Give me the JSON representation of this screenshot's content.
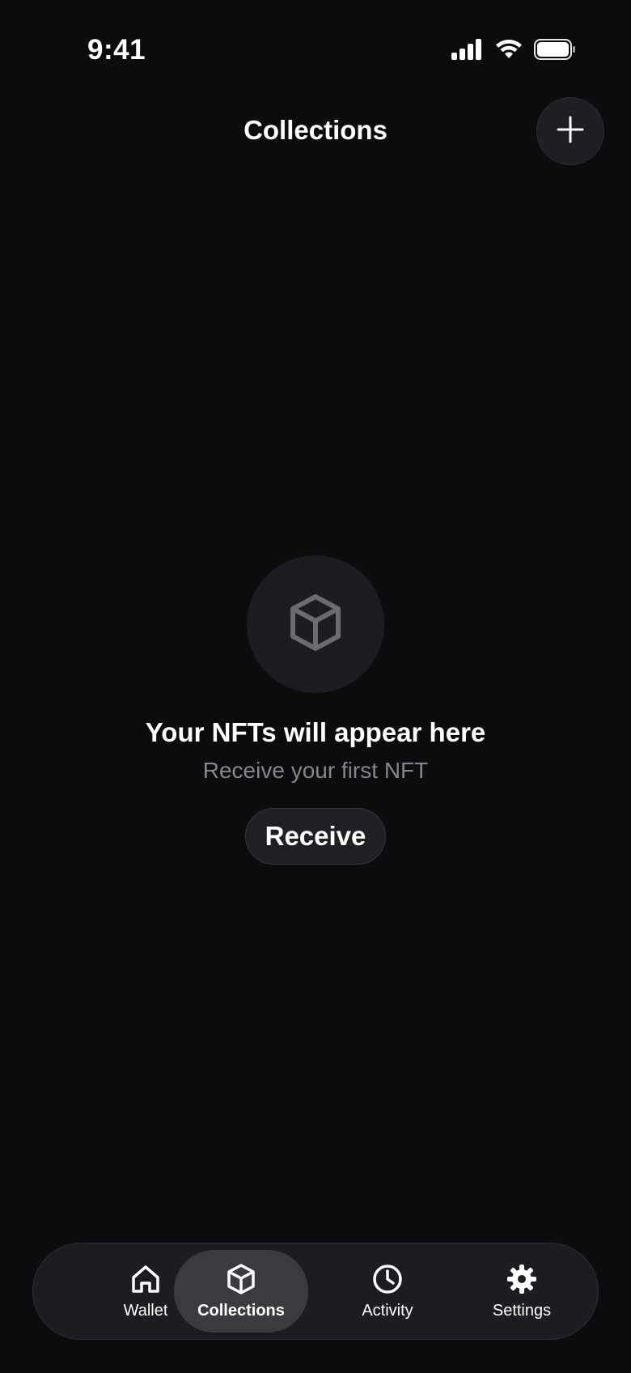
{
  "status_bar": {
    "time": "9:41",
    "icons": [
      "signal-icon",
      "wifi-icon",
      "battery-icon"
    ]
  },
  "header": {
    "title": "Collections",
    "add_icon": "plus-icon"
  },
  "empty_state": {
    "icon": "cube-icon",
    "title": "Your NFTs will appear here",
    "subtitle": "Receive your first NFT",
    "button_label": "Receive"
  },
  "tab_bar": {
    "tabs": [
      {
        "label": "Wallet",
        "icon": "home-icon",
        "active": false
      },
      {
        "label": "Collections",
        "icon": "cube-icon",
        "active": true
      },
      {
        "label": "Activity",
        "icon": "clock-icon",
        "active": false
      },
      {
        "label": "Settings",
        "icon": "gear-icon",
        "active": false
      }
    ]
  },
  "colors": {
    "background": "#0c0c0e",
    "surface": "#1c1d20",
    "active_tab": "#3a3b3f",
    "muted_text": "#85868c",
    "empty_icon": "#6b6c72"
  }
}
